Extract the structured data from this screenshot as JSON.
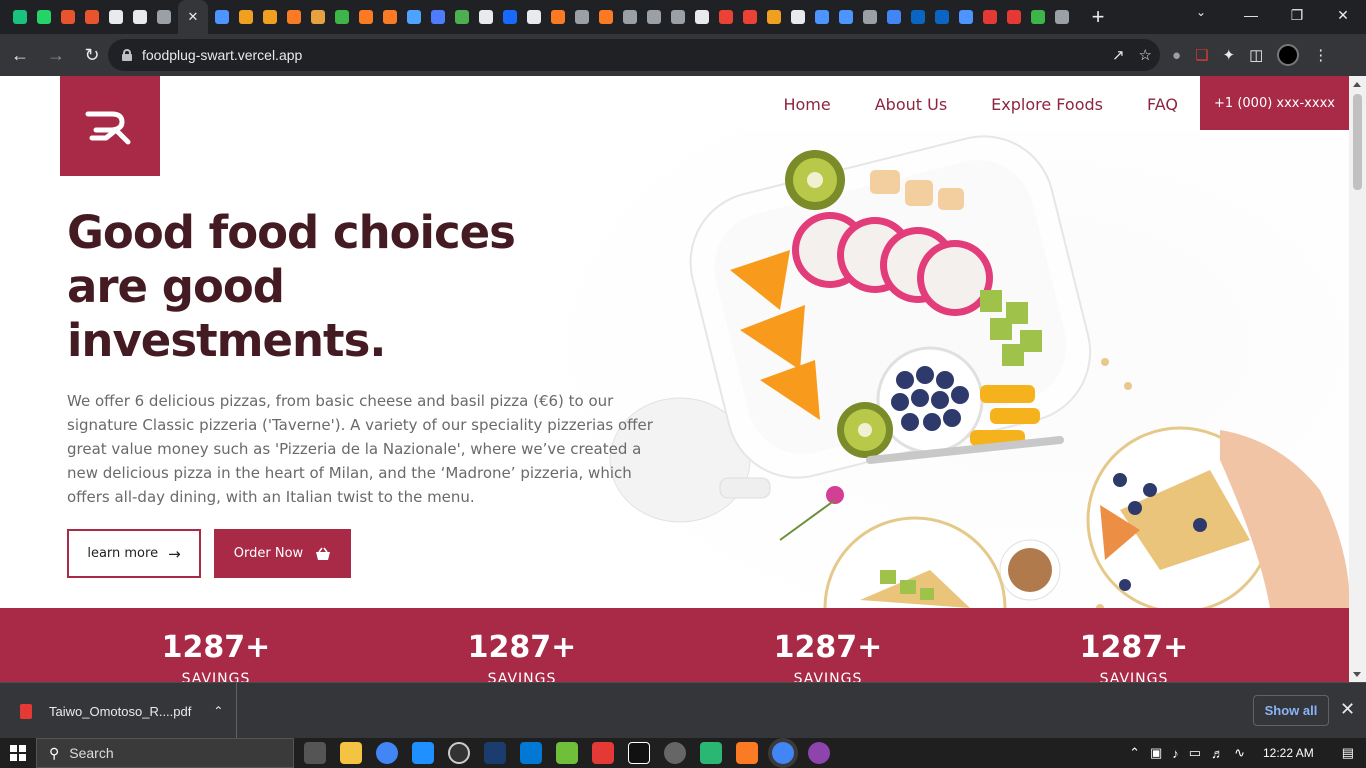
{
  "browser": {
    "url": "foodplug-swart.vercel.app",
    "tab_icons": [
      {
        "icon": "chatgpt-icon",
        "color": "#19c37d"
      },
      {
        "icon": "whatsapp-icon",
        "color": "#25d366"
      },
      {
        "icon": "chart-icon",
        "color": "#e8542e"
      },
      {
        "icon": "chart-icon",
        "color": "#e8542e"
      },
      {
        "icon": "github-icon",
        "color": "#e8eaed"
      },
      {
        "icon": "triangle-icon",
        "color": "#e8eaed"
      },
      {
        "icon": "globe-icon",
        "color": "#9aa0a6"
      },
      {
        "icon": "globe-icon",
        "color": "#4d94ff"
      },
      {
        "icon": "sun-icon",
        "color": "#f0a020"
      },
      {
        "icon": "sun-icon",
        "color": "#f0a020"
      },
      {
        "icon": "xampp-icon",
        "color": "#fb7a24"
      },
      {
        "icon": "rainbow-icon",
        "color": "#e6a141"
      },
      {
        "icon": "n-icon",
        "color": "#3eb549"
      },
      {
        "icon": "xampp-icon",
        "color": "#fb7a24"
      },
      {
        "icon": "xampp-icon",
        "color": "#fb7a24"
      },
      {
        "icon": "grid-icon",
        "color": "#4da3ff"
      },
      {
        "icon": "flag-icon",
        "color": "#4d7cff"
      },
      {
        "icon": "badge-icon",
        "color": "#4caf50"
      },
      {
        "icon": "triangle-icon",
        "color": "#e8eaed"
      },
      {
        "icon": "behance-icon",
        "color": "#1769ff"
      },
      {
        "icon": "gear-icon",
        "color": "#e8eaed"
      },
      {
        "icon": "xampp-icon",
        "color": "#fb7a24"
      },
      {
        "icon": "globe-icon",
        "color": "#9aa0a6"
      },
      {
        "icon": "xampp-icon",
        "color": "#fb7a24"
      },
      {
        "icon": "globe-icon",
        "color": "#9aa0a6"
      },
      {
        "icon": "globe-icon",
        "color": "#9aa0a6"
      },
      {
        "icon": "globe-icon",
        "color": "#9aa0a6"
      },
      {
        "icon": "hex-icon",
        "color": "#e8eaed"
      },
      {
        "icon": "gmail-icon",
        "color": "#ea4335"
      },
      {
        "icon": "gmail-icon",
        "color": "#ea4335"
      },
      {
        "icon": "sun-icon",
        "color": "#f0a020"
      },
      {
        "icon": "hex-icon",
        "color": "#e8eaed"
      },
      {
        "icon": "v-icon",
        "color": "#4d94ff"
      },
      {
        "icon": "v-icon",
        "color": "#4d94ff"
      },
      {
        "icon": "globe-icon",
        "color": "#9aa0a6"
      },
      {
        "icon": "google-icon",
        "color": "#4285f4"
      },
      {
        "icon": "linkedin-icon",
        "color": "#0a66c2"
      },
      {
        "icon": "linkedin-icon",
        "color": "#0a66c2"
      },
      {
        "icon": "c-icon",
        "color": "#4d94ff"
      },
      {
        "icon": "p-icon",
        "color": "#e53935"
      },
      {
        "icon": "p-icon",
        "color": "#e53935"
      },
      {
        "icon": "v-icon",
        "color": "#3eb549"
      },
      {
        "icon": "globe-icon",
        "color": "#9aa0a6"
      }
    ]
  },
  "site": {
    "accent": "#a82a47",
    "nav": [
      "Home",
      "About Us",
      "Explore Foods",
      "FAQ"
    ],
    "phone": "+1 (000) xxx-xxxx",
    "hero": {
      "title": "Good food choices are good investments.",
      "text": "We offer 6 delicious pizzas, from basic cheese and basil pizza (€6) to our signature Classic pizzeria ('Taverne'). A variety of our speciality pizzerias offer great value money such as 'Pizzeria de la Nazionale', where we’ve created a new delicious pizza in the heart of Milan, and the ‘Madrone’ pizzeria, which offers all-day dining, with an Italian twist to the menu.",
      "learn_more": "learn more",
      "order_now": "Order Now"
    },
    "stats": [
      {
        "value": "1287+",
        "label": "SAVINGS"
      },
      {
        "value": "1287+",
        "label": "SAVINGS"
      },
      {
        "value": "1287+",
        "label": "SAVINGS"
      },
      {
        "value": "1287+",
        "label": "SAVINGS"
      }
    ]
  },
  "downloads": {
    "file": "Taiwo_Omotoso_R....pdf",
    "show_all": "Show all"
  },
  "taskbar": {
    "search": "Search",
    "time": "12:22 AM"
  }
}
